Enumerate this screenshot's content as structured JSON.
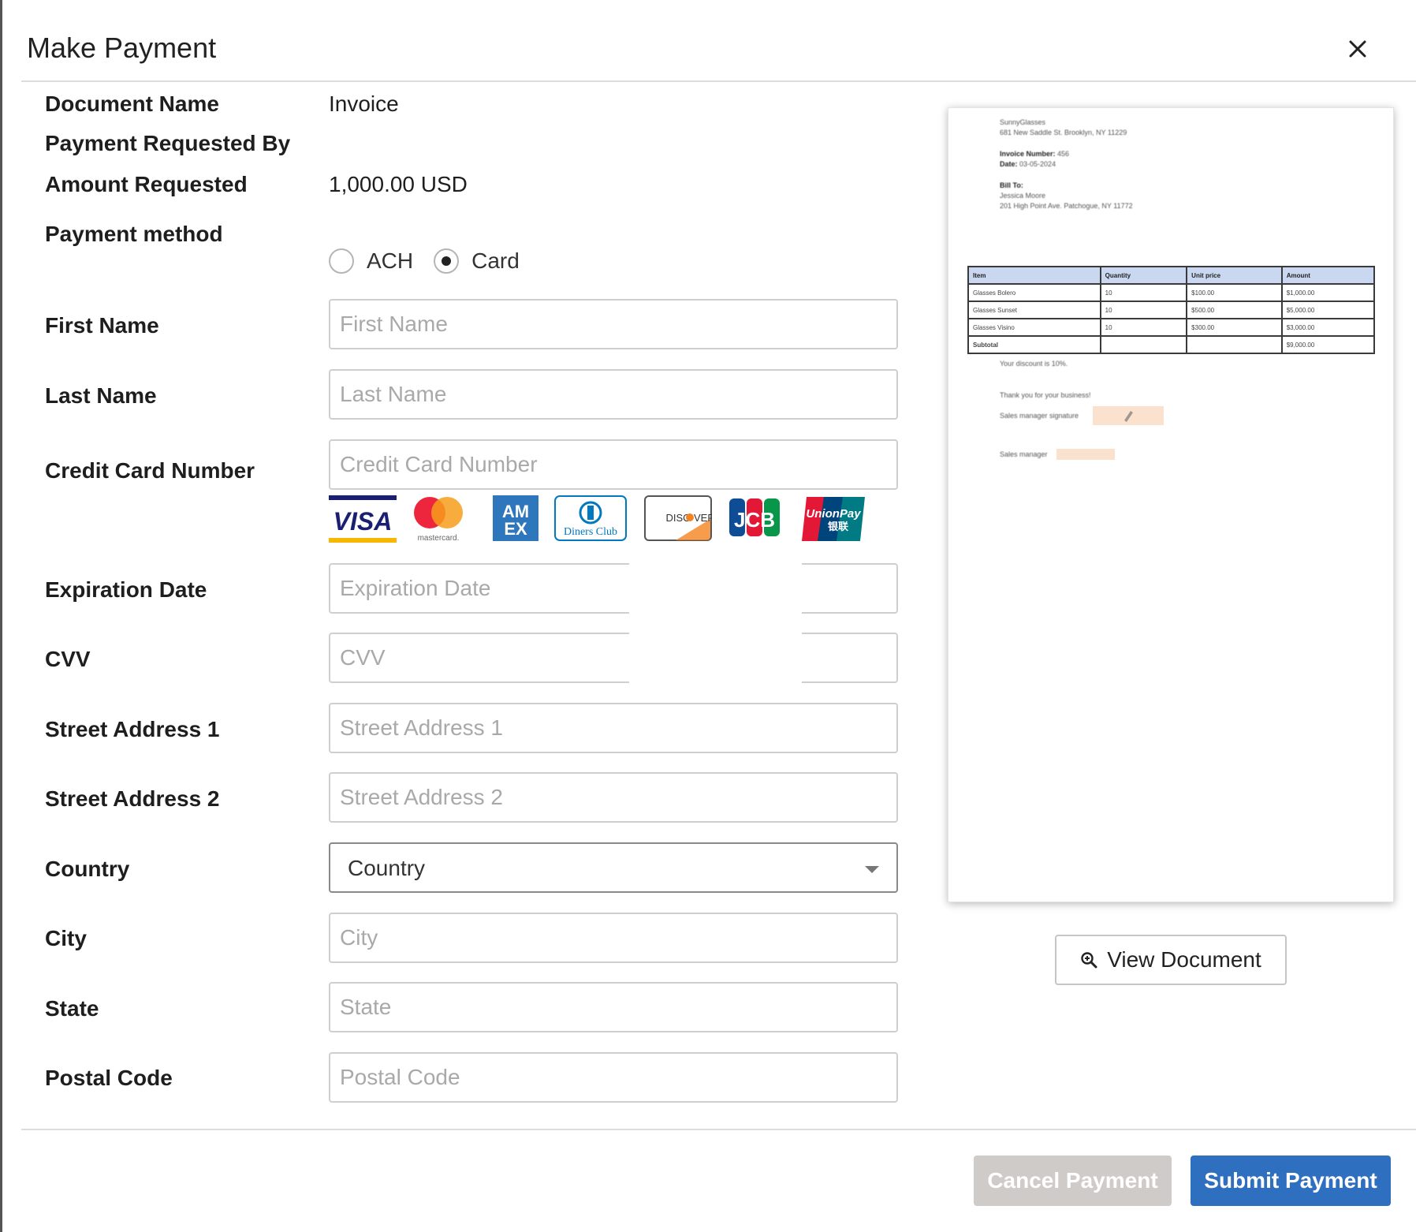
{
  "modal": {
    "title": "Make Payment"
  },
  "details": {
    "document_name_label": "Document Name",
    "document_name_value": "Invoice",
    "requested_by_label": "Payment Requested By",
    "requested_by_value": "",
    "amount_label": "Amount Requested",
    "amount_value": "1,000.00 USD",
    "payment_method_label": "Payment method",
    "payment_methods": [
      {
        "label": "ACH",
        "selected": false
      },
      {
        "label": "Card",
        "selected": true
      }
    ]
  },
  "fields": {
    "first_name": {
      "label": "First Name",
      "placeholder": "First Name",
      "value": ""
    },
    "last_name": {
      "label": "Last Name",
      "placeholder": "Last Name",
      "value": ""
    },
    "card_number": {
      "label": "Credit Card Number",
      "placeholder": "Credit Card Number",
      "value": ""
    },
    "expiration": {
      "label": "Expiration Date",
      "placeholder": "Expiration Date",
      "value": ""
    },
    "cvv": {
      "label": "CVV",
      "placeholder": "CVV",
      "value": ""
    },
    "street1": {
      "label": "Street Address 1",
      "placeholder": "Street Address 1",
      "value": ""
    },
    "street2": {
      "label": "Street Address 2",
      "placeholder": "Street Address 2",
      "value": ""
    },
    "country": {
      "label": "Country",
      "selected": "Country"
    },
    "city": {
      "label": "City",
      "placeholder": "City",
      "value": ""
    },
    "state": {
      "label": "State",
      "placeholder": "State",
      "value": ""
    },
    "postal": {
      "label": "Postal Code",
      "placeholder": "Postal Code",
      "value": ""
    }
  },
  "card_brands": [
    {
      "name": "VISA",
      "icon": "visa-icon"
    },
    {
      "name": "mastercard",
      "icon": "mastercard-icon"
    },
    {
      "name": "AMEX",
      "icon": "amex-icon"
    },
    {
      "name": "Diners Club",
      "icon": "diners-club-icon"
    },
    {
      "name": "DISCOVER",
      "icon": "discover-icon"
    },
    {
      "name": "JCB",
      "icon": "jcb-icon"
    },
    {
      "name": "UnionPay 银联",
      "icon": "unionpay-icon"
    }
  ],
  "document_preview": {
    "company": "SunnyGlasses",
    "company_address": "681 New Saddle St. Brooklyn, NY 11229",
    "invoice_number_label": "Invoice Number:",
    "invoice_number": "456",
    "date_label": "Date:",
    "date": "03-05-2024",
    "bill_to_label": "Bill To:",
    "bill_to_name": "Jessica Moore",
    "bill_to_address": "201 High Point Ave. Patchogue, NY 11772",
    "table_headers": [
      "Item",
      "Quantity",
      "Unit price",
      "Amount"
    ],
    "table_rows": [
      [
        "Glasses Bolero",
        "10",
        "$100.00",
        "$1,000.00"
      ],
      [
        "Glasses Sunset",
        "10",
        "$500.00",
        "$5,000.00"
      ],
      [
        "Glasses Visino",
        "10",
        "$300.00",
        "$3,000.00"
      ],
      [
        "Subtotal",
        "",
        "",
        "$9,000.00"
      ]
    ],
    "discount_note": "Your discount is 10%.",
    "thanks_note": "Thank you for your business!",
    "signature_label": "Sales manager signature",
    "manager_label": "Sales manager"
  },
  "actions": {
    "view_document": "View Document",
    "cancel": "Cancel Payment",
    "submit": "Submit Payment"
  },
  "colors": {
    "primary": "#2f6fbf",
    "cancel_disabled": "#cfcbc8",
    "table_header": "#c9d7f0",
    "signature_highlight": "#fbe2cf"
  }
}
